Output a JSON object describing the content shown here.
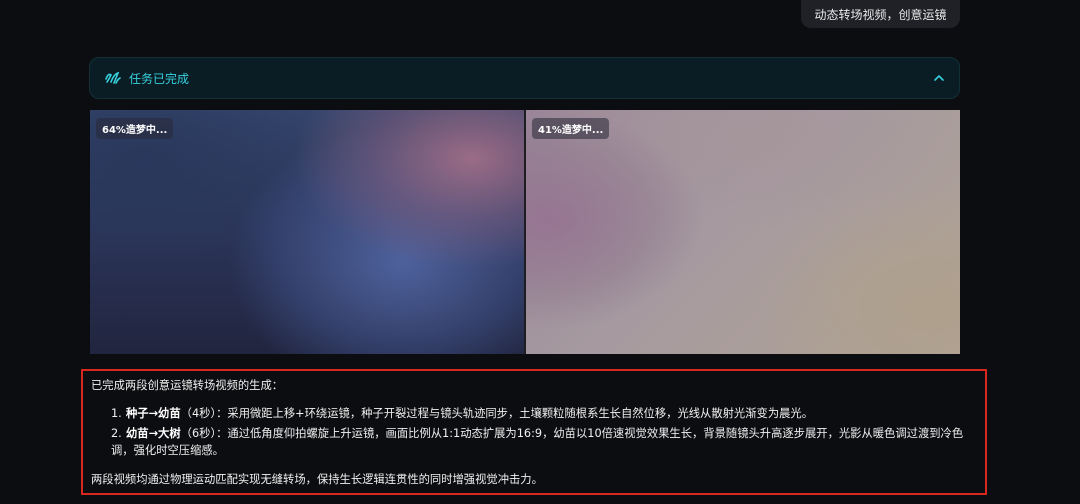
{
  "user_message": "动态转场视频，创意运镜",
  "task": {
    "status_label": "任务已完成"
  },
  "videos": [
    {
      "progress_label": "64%造梦中...",
      "progress": 64
    },
    {
      "progress_label": "41%造梦中...",
      "progress": 41
    }
  ],
  "response": {
    "intro": "已完成两段创意运镜转场视频的生成：",
    "items": [
      {
        "num": "1.",
        "title": "种子→幼苗",
        "duration": "（4秒）",
        "body": "：采用微距上移+环绕运镜，种子开裂过程与镜头轨迹同步，土壤颗粒随根系生长自然位移，光线从散射光渐变为晨光。"
      },
      {
        "num": "2.",
        "title": "幼苗→大树",
        "duration": "（6秒）",
        "body": "：通过低角度仰拍螺旋上升运镜，画面比例从1:1动态扩展为16:9，幼苗以10倍速视觉效果生长，背景随镜头升高逐步展开，光影从暖色调过渡到冷色调，强化时空压缩感。"
      }
    ],
    "summary": "两段视频均通过物理运动匹配实现无缝转场，保持生长逻辑连贯性的同时增强视觉冲击力。"
  },
  "colors": {
    "accent": "#36d0dd",
    "highlight_border": "#d8281e",
    "background": "#0c0d10"
  }
}
